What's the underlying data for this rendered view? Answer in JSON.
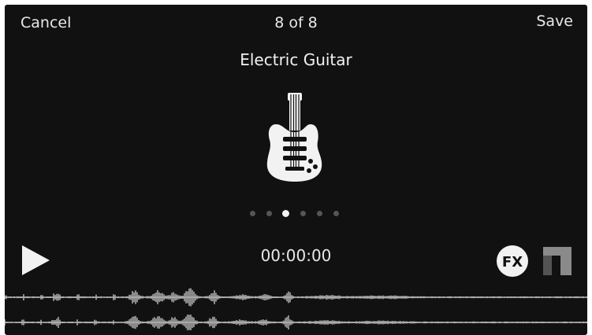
{
  "topbar": {
    "cancel_label": "Cancel",
    "counter": "8 of 8",
    "save_label": "Save"
  },
  "instrument": {
    "name": "Electric Guitar",
    "icon": "electric-guitar-icon"
  },
  "pager": {
    "total": 6,
    "active_index": 2
  },
  "transport": {
    "time": "00:00:00",
    "play_icon": "play-icon",
    "fx_label": "FX",
    "trim_icon": "trim-icon"
  },
  "colors": {
    "background": "#111111",
    "foreground": "#f2f2f2",
    "inactive_dot": "#555555",
    "waveform": "#bdbdbd",
    "icon_grey": "#8a8a8a"
  }
}
